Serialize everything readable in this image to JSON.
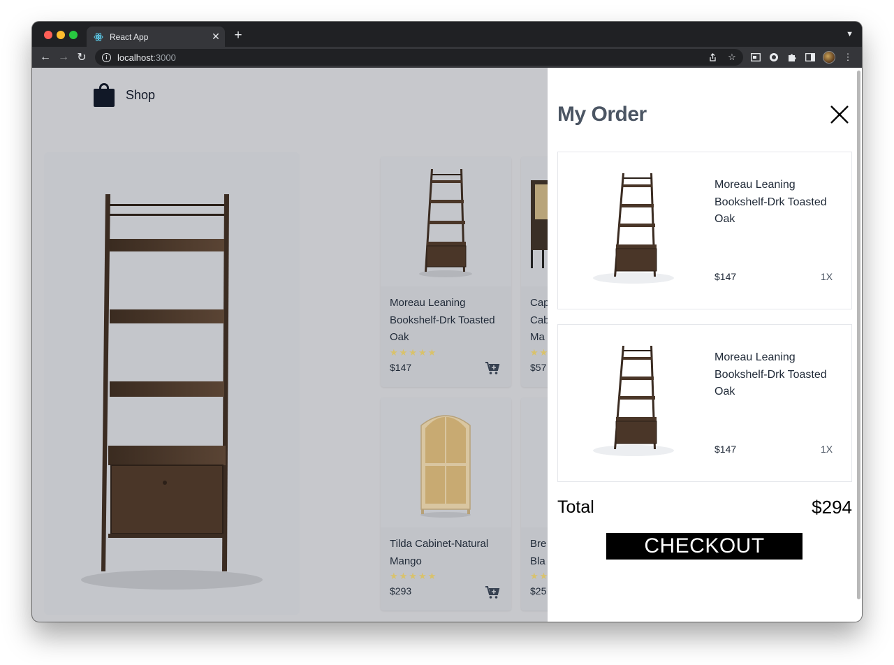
{
  "browser": {
    "tab_title": "React App",
    "tab_close": "✕",
    "new_tab": "+",
    "url_host": "localhost",
    "url_port": ":3000"
  },
  "shop": {
    "title": "Shop"
  },
  "products": [
    {
      "name": "Moreau Leaning Bookshelf-Drk Toasted Oak",
      "price": "$147",
      "rating": "★★★★★"
    },
    {
      "name": "Cap Cab Ma",
      "price": "$57",
      "rating": "★★"
    },
    {
      "name": "Tilda Cabinet-Natural Mango",
      "price": "$293",
      "rating": "★★★★★"
    },
    {
      "name": "Bre Bla",
      "price": "$25",
      "rating": "★★"
    }
  ],
  "drawer": {
    "title": "My Order",
    "items": [
      {
        "name": "Moreau Leaning Bookshelf-Drk Toasted Oak",
        "price": "$147",
        "qty": "1X"
      },
      {
        "name": "Moreau Leaning Bookshelf-Drk Toasted Oak",
        "price": "$147",
        "qty": "1X"
      }
    ],
    "total_label": "Total",
    "total_value": "$294",
    "checkout_label": "CHECKOUT"
  },
  "colors": {
    "chrome_dark": "#202124",
    "chrome_mid": "#35363a",
    "page_bg": "#c7c8cc",
    "star": "#d9c26a",
    "checkout_bg": "#000000"
  }
}
